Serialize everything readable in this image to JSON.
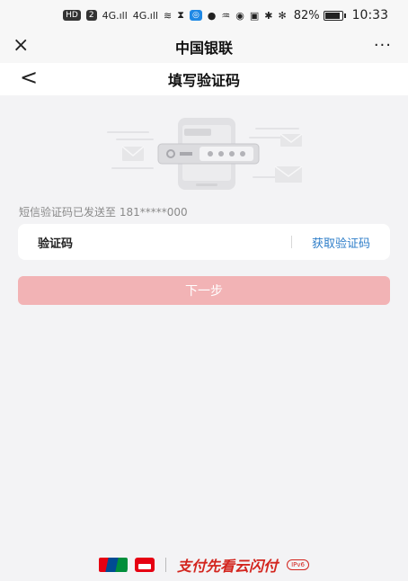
{
  "status_bar": {
    "icons": [
      "HD",
      "2",
      "4G",
      "4G"
    ],
    "battery_percent": "82%",
    "battery_level": 0.82,
    "time": "10:33"
  },
  "app_bar": {
    "close_icon": "×",
    "title": "中国银联",
    "more_icon": "···"
  },
  "nav_bar": {
    "back_icon": "<",
    "title": "填写验证码"
  },
  "hint": {
    "prefix": "短信验证码已发送至 ",
    "phone": "181*****000"
  },
  "code_form": {
    "label": "验证码",
    "value": "",
    "get_code_label": "获取验证码"
  },
  "next_button": {
    "label": "下一步"
  },
  "footer": {
    "slogan": "支付先看云闪付",
    "badge": "IPv6"
  },
  "colors": {
    "accent_blue": "#2e7ec9",
    "button_disabled": "#f2b3b5",
    "brand_red": "#d3251e",
    "unionpay_red": "#e60012",
    "unionpay_blue": "#004b93",
    "unionpay_green": "#008e3b"
  }
}
